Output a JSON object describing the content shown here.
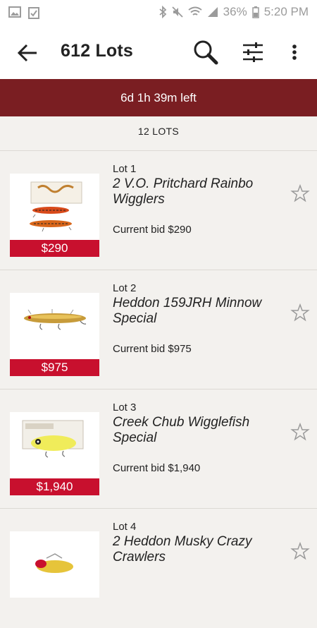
{
  "status_bar": {
    "battery": "36%",
    "time": "5:20 PM"
  },
  "header": {
    "title": "612 Lots",
    "icons": [
      "back-arrow-icon",
      "search-icon",
      "filter-sliders-icon",
      "more-vert-icon"
    ]
  },
  "timer": {
    "text": "6d 1h 39m left",
    "color": "#7a1e22"
  },
  "lots_count": "12 LOTS",
  "accent_price_color": "#c8102e",
  "lots": [
    {
      "number": "Lot 1",
      "title": "2 V.O. Pritchard Rainbo Wigglers",
      "bid": "Current bid $290",
      "price": "$290"
    },
    {
      "number": "Lot 2",
      "title": "Heddon 159JRH Minnow Special",
      "bid": "Current bid $975",
      "price": "$975"
    },
    {
      "number": "Lot 3",
      "title": "Creek Chub Wigglefish Special",
      "bid": "Current bid $1,940",
      "price": "$1,940"
    },
    {
      "number": "Lot 4",
      "title": "2 Heddon Musky Crazy Crawlers",
      "bid": "",
      "price": ""
    }
  ]
}
